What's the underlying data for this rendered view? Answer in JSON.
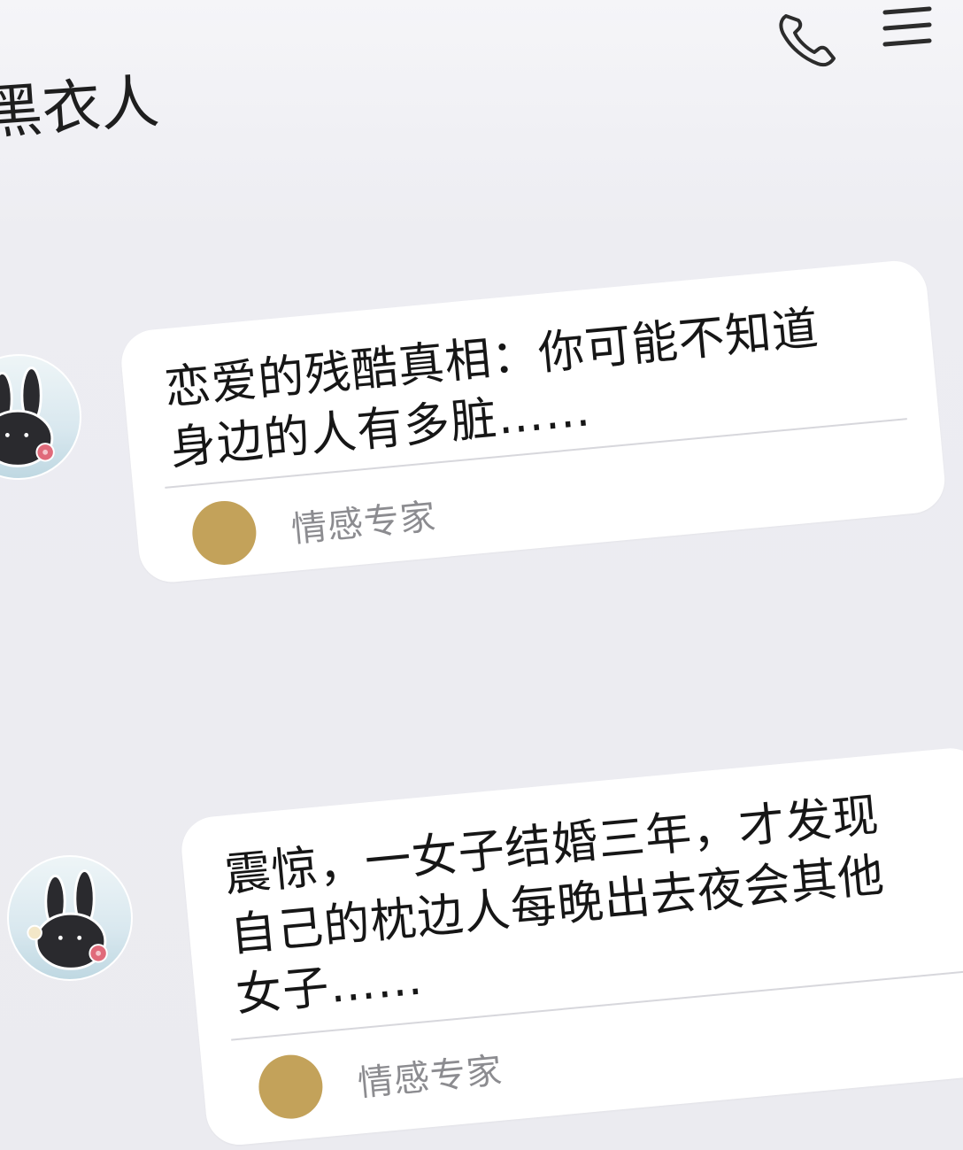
{
  "header": {
    "title": "黑衣人",
    "call_icon": "phone-icon",
    "menu_icon": "menu-icon"
  },
  "messages": [
    {
      "avatar_icon": "black-rabbit-avatar",
      "text": "恋爱的残酷真相：你可能不知道\n身边的人有多脏……",
      "source_name": "情感专家"
    },
    {
      "avatar_icon": "black-rabbit-avatar",
      "text": "震惊，一女子结婚三年，才发现\n自己的枕边人每晚出去夜会其他\n女子……",
      "source_name": "情感专家"
    }
  ],
  "colors": {
    "background": "#ebebf0",
    "card": "#ffffff",
    "source_avatar": "#c3a25a",
    "source_text": "#8c8c90"
  }
}
